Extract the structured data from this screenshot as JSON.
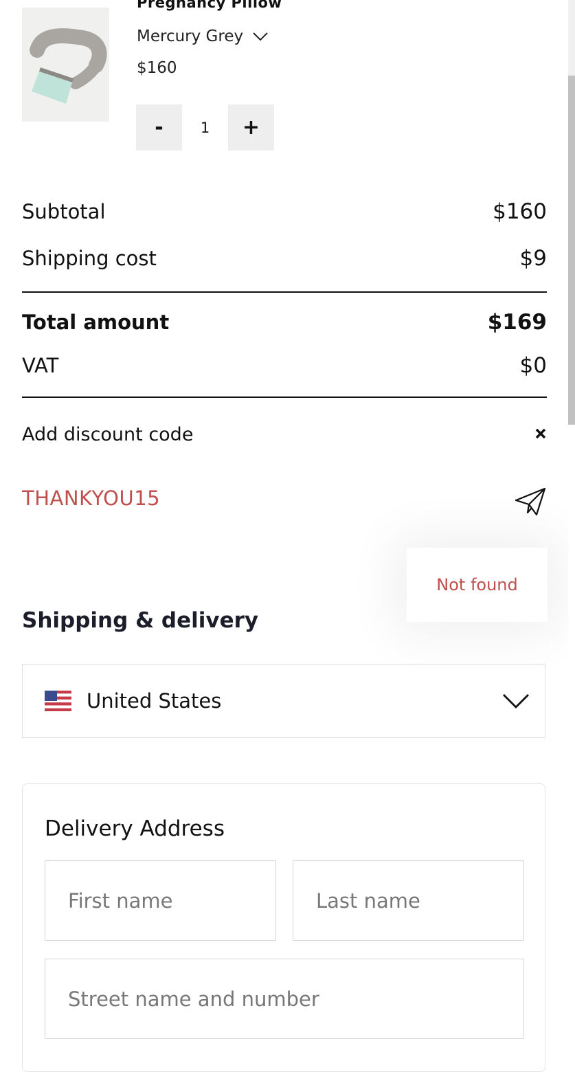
{
  "product": {
    "name": "Pregnancy Pillow",
    "variant": "Mercury Grey",
    "price": "$160",
    "quantity": "1",
    "minus_label": "-",
    "plus_label": "+"
  },
  "summary": {
    "subtotal_label": "Subtotal",
    "subtotal_value": "$160",
    "shipping_label": "Shipping cost",
    "shipping_value": "$9",
    "total_label": "Total amount",
    "total_value": "$169",
    "vat_label": "VAT",
    "vat_value": "$0"
  },
  "discount": {
    "label": "Add discount code",
    "code": "THANKYOU15",
    "error": "Not found"
  },
  "shipping": {
    "title": "Shipping & delivery",
    "country": "United States"
  },
  "address": {
    "title": "Delivery Address",
    "first_name_placeholder": "First name",
    "last_name_placeholder": "Last name",
    "street_placeholder": "Street name and number"
  },
  "colors": {
    "error": "#c0504d",
    "button_bg": "#eeeeee"
  },
  "icons": [
    "chevron-down-icon",
    "close-icon",
    "send-icon",
    "us-flag-icon"
  ]
}
